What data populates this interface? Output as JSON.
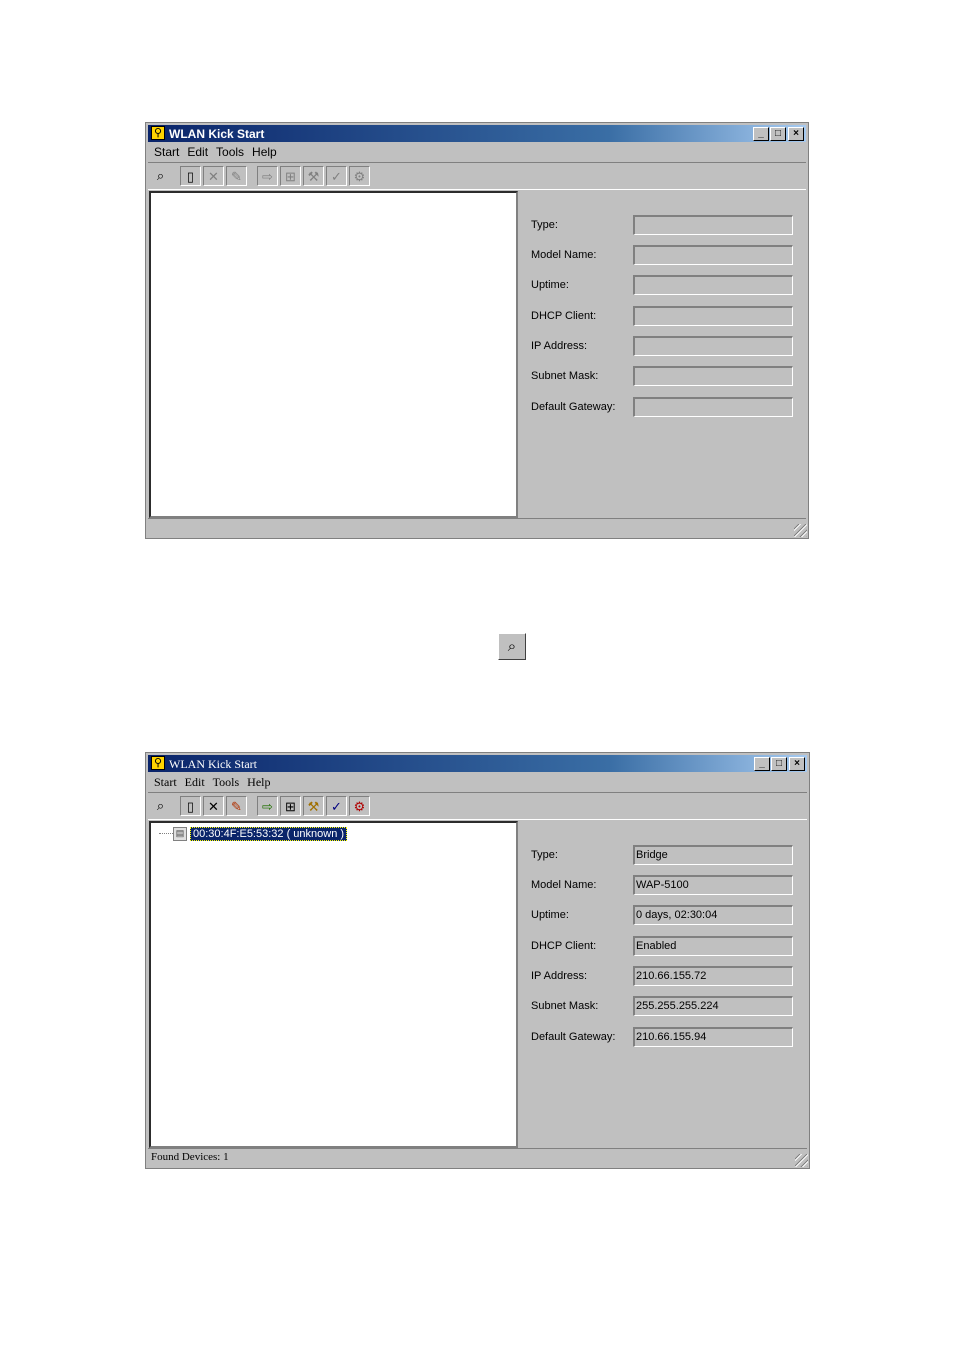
{
  "app_title": "WLAN Kick Start",
  "window_buttons": {
    "minimize": "_",
    "maximize": "□",
    "close": "×"
  },
  "menu": [
    "Start",
    "Edit",
    "Tools",
    "Help"
  ],
  "toolbar_icons": [
    "binoculars-icon",
    "new-document-icon",
    "delete-icon",
    "edit-icon",
    "device-config-icon",
    "security-icon",
    "wrench-icon",
    "upgrade-icon",
    "reset-icon"
  ],
  "field_labels": {
    "type": "Type:",
    "model_name": "Model Name:",
    "uptime": "Uptime:",
    "dhcp_client": "DHCP Client:",
    "ip_address": "IP Address:",
    "subnet_mask": "Subnet Mask:",
    "default_gateway": "Default Gateway:"
  },
  "window1": {
    "status": ""
  },
  "window2": {
    "device_label": "00:30:4F:E5:53:32 ( unknown )",
    "values": {
      "type": "Bridge",
      "model_name": "WAP-5100",
      "uptime": "0 days, 02:30:04",
      "dhcp_client": "Enabled",
      "ip_address": "210.66.155.72",
      "subnet_mask": "255.255.255.224",
      "default_gateway": "210.66.155.94"
    },
    "status": "Found Devices: 1"
  }
}
